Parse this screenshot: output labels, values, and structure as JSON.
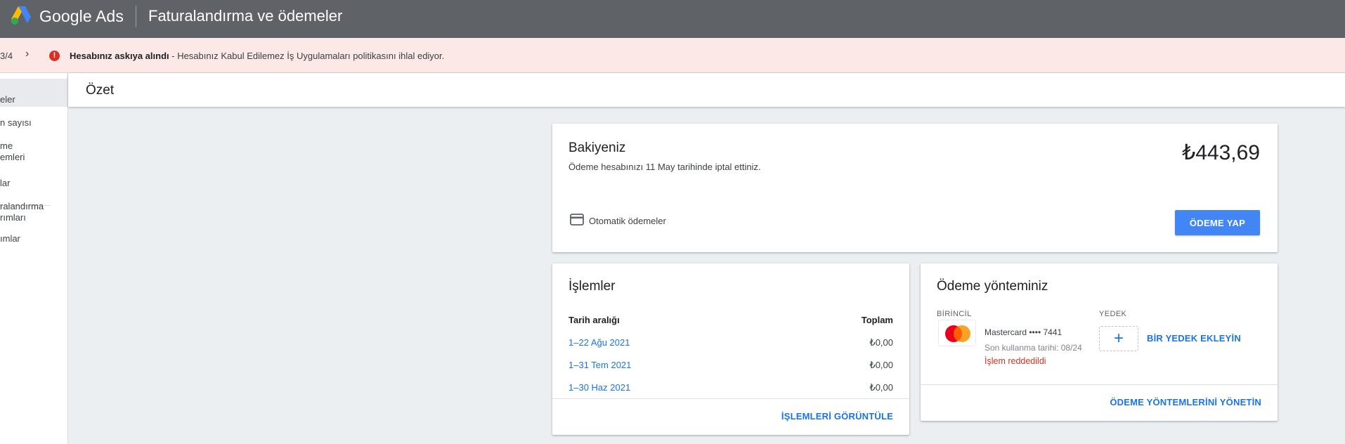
{
  "header": {
    "brand": "Google Ads",
    "page_title": "Faturalandırma ve ödemeler"
  },
  "alert": {
    "counter": "3/4",
    "next_glyph": "›",
    "icon_glyph": "!",
    "title": "Hesabınız askıya alındı",
    "separator": " - ",
    "message": "Hesabınız Kabul Edilemez İş Uygulamaları politikasını ihlal ediyor."
  },
  "sidebar": {
    "items": [
      {
        "line1": "eler",
        "line2": ""
      },
      {
        "line1": "n sayısı",
        "line2": ""
      },
      {
        "line1": "me",
        "line2": "emleri"
      },
      {
        "line1": "lar",
        "line2": ""
      },
      {
        "line1": "ralandırma",
        "line2": "rımları"
      },
      {
        "line1": "ımlar",
        "line2": ""
      }
    ]
  },
  "summary": {
    "title": "Özet"
  },
  "balance": {
    "title": "Bakiyeniz",
    "subtitle": "Ödeme hesabınızı 11 May tarihinde iptal ettiniz.",
    "amount": "₺443,69",
    "auto_payments": "Otomatik ödemeler",
    "pay_button": "ÖDEME YAP"
  },
  "transactions": {
    "title": "İşlemler",
    "col_date": "Tarih aralığı",
    "col_total": "Toplam",
    "rows": [
      {
        "date": "1–22 Ağu 2021",
        "amount": "₺0,00"
      },
      {
        "date": "1–31 Tem 2021",
        "amount": "₺0,00"
      },
      {
        "date": "1–30 Haz 2021",
        "amount": "₺0,00"
      }
    ],
    "view_button": "İŞLEMLERİ GÖRÜNTÜLE"
  },
  "payment_method": {
    "title": "Ödeme yönteminiz",
    "primary_label": "BİRİNCİL",
    "backup_label": "YEDEK",
    "card_name": "Mastercard •••• 7441",
    "expiry": "Son kullanma tarihi: 08/24",
    "status": "İşlem reddedildi",
    "add_backup": "BİR YEDEK EKLEYİN",
    "plus_glyph": "+",
    "manage_button": "ÖDEME YÖNTEMLERİNİ YÖNETİN"
  },
  "colors": {
    "header_bg": "#5f6368",
    "alert_bg": "#fce8e6",
    "alert_icon": "#d93025",
    "primary_blue": "#4285f4",
    "link_blue": "#1a73e8",
    "error_red": "#d93025"
  },
  "icons": {
    "logo": "google-ads-logo",
    "card": "credit-card-icon",
    "mastercard": "mastercard-logo",
    "alert": "error-icon"
  }
}
